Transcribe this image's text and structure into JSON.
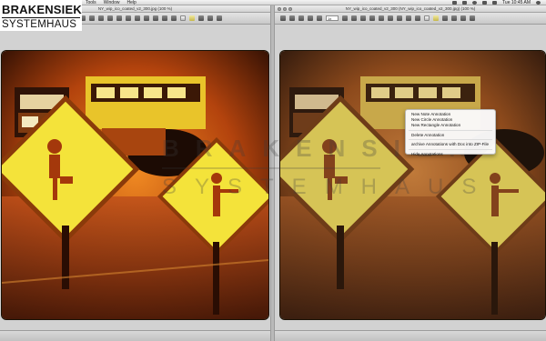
{
  "logo": {
    "line1": "BRAKENSIEK",
    "line2": "SYSTEMHAUS"
  },
  "menubar": {
    "menus": [
      "Tools",
      "Window",
      "Help"
    ],
    "clock": "Tue 10:45 AM"
  },
  "left_window": {
    "title": "NY_wip_ico_coated_v2_300.jpg (100 %)"
  },
  "right_window": {
    "title": "NY_wip_ico_coated_v2_300 (NY_wip_ico_coated_v2_300.jpg) (100 %)",
    "zoom": "1x"
  },
  "watermark": {
    "line1": "BRAKENSIEK",
    "line2": "SYSTEMHAUS"
  },
  "context_menu": {
    "items": [
      "New Note Annotation",
      "New Circle Annotation",
      "New Rectangle Annotation",
      "Delete Annotation",
      "archive Annotations with Doc into ZIP-File",
      "Hide Annotations"
    ]
  },
  "colors": {
    "photo_orange": "#d9651a",
    "photo_dark": "#3a1606",
    "sign_yellow": "#f6e23a",
    "photo_dim": "#a05a25"
  }
}
